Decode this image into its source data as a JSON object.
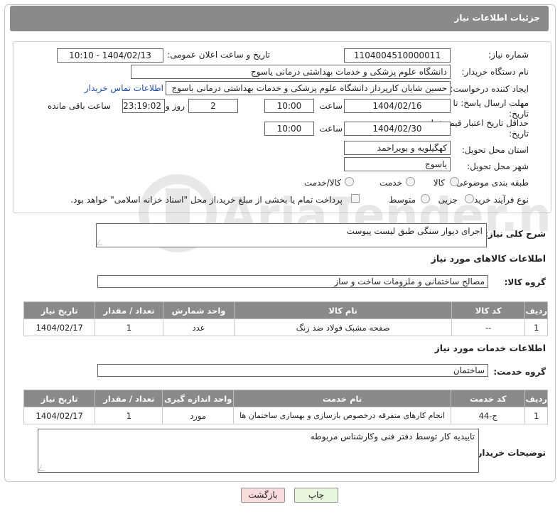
{
  "header": {
    "title": "جزئیات اطلاعات نیاز"
  },
  "form": {
    "need_number_label": "شماره نیاز:",
    "need_number": "1104004510000011",
    "announce_label": "تاریخ و ساعت اعلان عمومی:",
    "announce_value": "1404/02/13 - 10:10",
    "buyer_org_label": "نام دستگاه خریدار:",
    "buyer_org": "دانشگاه علوم پزشکی و خدمات بهداشتی  درمانی یاسوج",
    "creator_label": "ایجاد کننده درخواست:",
    "creator": "حسین شایان کارپرداز دانشگاه علوم پزشکی و خدمات بهداشتی  درمانی یاسوج",
    "contact_link": "اطلاعات تماس خریدار",
    "deadline_label": "مهلت ارسال پاسخ: تا تاریخ:",
    "deadline_date": "1404/02/16",
    "time_label": "ساعت",
    "deadline_time": "10:00",
    "days_value": "2",
    "days_label": "روز و",
    "remaining_time": "23:19:02",
    "remaining_label": "ساعت باقی مانده",
    "validity_label": "حداقل تاریخ اعتبار قیمت: تا تاریخ:",
    "validity_date": "1404/02/30",
    "validity_time": "10:00",
    "province_label": "استان محل تحویل:",
    "province": "کهگیلویه و بویراحمد",
    "city_label": "شهر محل تحویل:",
    "city": "یاسوج",
    "category_label": "طبقه بندی موضوعی:",
    "category_options": [
      "کالا",
      "خدمت",
      "کالا/خدمت"
    ],
    "process_label": "نوع فرآیند خرید :",
    "process_options": [
      "جزیی",
      "متوسط"
    ],
    "payment_note": "پرداخت تمام یا بخشی از مبلغ خرید،از محل \"اسناد خزانه اسلامی\" خواهد بود."
  },
  "description": {
    "label": "شرح کلی نیاز:",
    "value": "اجرای دیوار سنگی طبق لیست پیوست"
  },
  "goods": {
    "section_title": "اطلاعات کالاهای مورد نیاز",
    "group_label": "گروه کالا:",
    "group_value": "مصالح ساختمانی و ملزومات ساخت و ساز",
    "columns": [
      "ردیف",
      "کد کالا",
      "نام کالا",
      "واحد شمارش",
      "تعداد / مقدار",
      "تاریخ نیاز"
    ],
    "rows": [
      [
        "1",
        "--",
        "صفحه مشبک فولاد ضد زنگ",
        "عدد",
        "1",
        "1404/02/17"
      ]
    ]
  },
  "services": {
    "section_title": "اطلاعات خدمات مورد نیاز",
    "group_label": "گروه خدمت:",
    "group_value": "ساختمان",
    "columns": [
      "ردیف",
      "کد خدمت",
      "نام خدمت",
      "واحد اندازه گیری",
      "تعداد / مقدار",
      "تاریخ نیاز"
    ],
    "rows": [
      [
        "1",
        "ج-44",
        "انجام کارهای متفرقه درخصوص بازسازی و بهسازی ساختمان ها",
        "مورد",
        "1",
        "1404/02/17"
      ]
    ]
  },
  "buyer_notes": {
    "label": "توضیحات خریدار:",
    "value": "تاییدیه کار توسط دفتر فنی وکارشناس مربوطه"
  },
  "buttons": {
    "print": "چاپ",
    "back": "بازگشت"
  },
  "watermark": {
    "brand": "AriaTender.net"
  }
}
